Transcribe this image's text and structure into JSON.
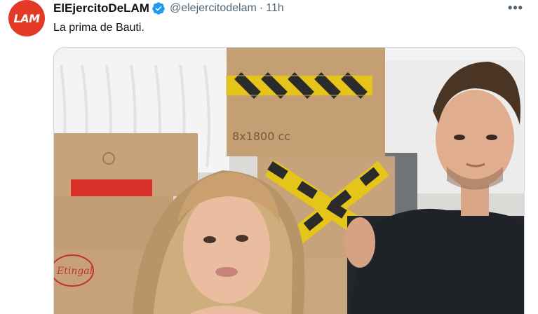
{
  "tweet": {
    "avatar_text": "LAM",
    "display_name": "ElEjercitoDeLAM",
    "verified_icon": "verified-badge-icon",
    "handle": "@elejercitodelam",
    "separator": "·",
    "time": "11h",
    "more_icon": "more-horizontal-icon",
    "text": "La prima de Bauti."
  },
  "media": {
    "box_top_label": "8x1800 cc",
    "box_logo_text": "Etingal"
  },
  "colors": {
    "avatar_bg": "#e23a26",
    "verified_blue": "#1d9bf0",
    "text_primary": "#0f1419",
    "text_secondary": "#536471"
  }
}
